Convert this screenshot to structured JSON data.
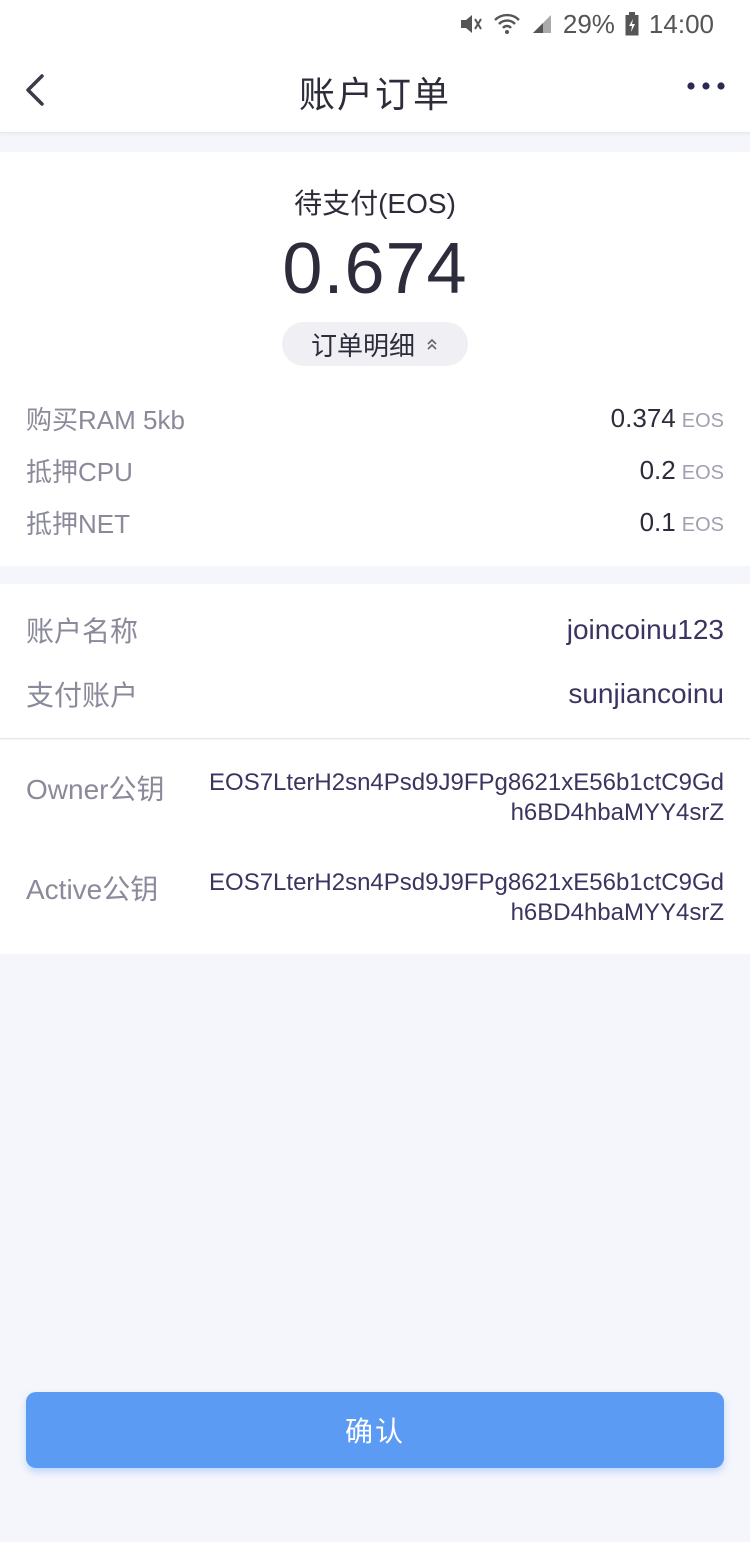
{
  "status_bar": {
    "battery": "29%",
    "time": "14:00"
  },
  "header": {
    "title": "账户订单"
  },
  "summary": {
    "pending_label": "待支付(EOS)",
    "amount": "0.674",
    "detail_button": "订单明细"
  },
  "order_items": [
    {
      "label": "购买RAM 5kb",
      "value": "0.374",
      "unit": "EOS"
    },
    {
      "label": "抵押CPU",
      "value": "0.2",
      "unit": "EOS"
    },
    {
      "label": "抵押NET",
      "value": "0.1",
      "unit": "EOS"
    }
  ],
  "account": {
    "name_label": "账户名称",
    "name_value": "joincoinu123",
    "payer_label": "支付账户",
    "payer_value": "sunjiancoinu"
  },
  "keys": {
    "owner_label": "Owner公钥",
    "owner_value": "EOS7LterH2sn4Psd9J9FPg8621xE56b1ctC9Gdh6BD4hbaMYY4srZ",
    "active_label": "Active公钥",
    "active_value": "EOS7LterH2sn4Psd9J9FPg8621xE56b1ctC9Gdh6BD4hbaMYY4srZ"
  },
  "footer": {
    "confirm_label": "确认"
  },
  "colors": {
    "accent": "#5b9bf4",
    "background": "#f5f6fc"
  }
}
